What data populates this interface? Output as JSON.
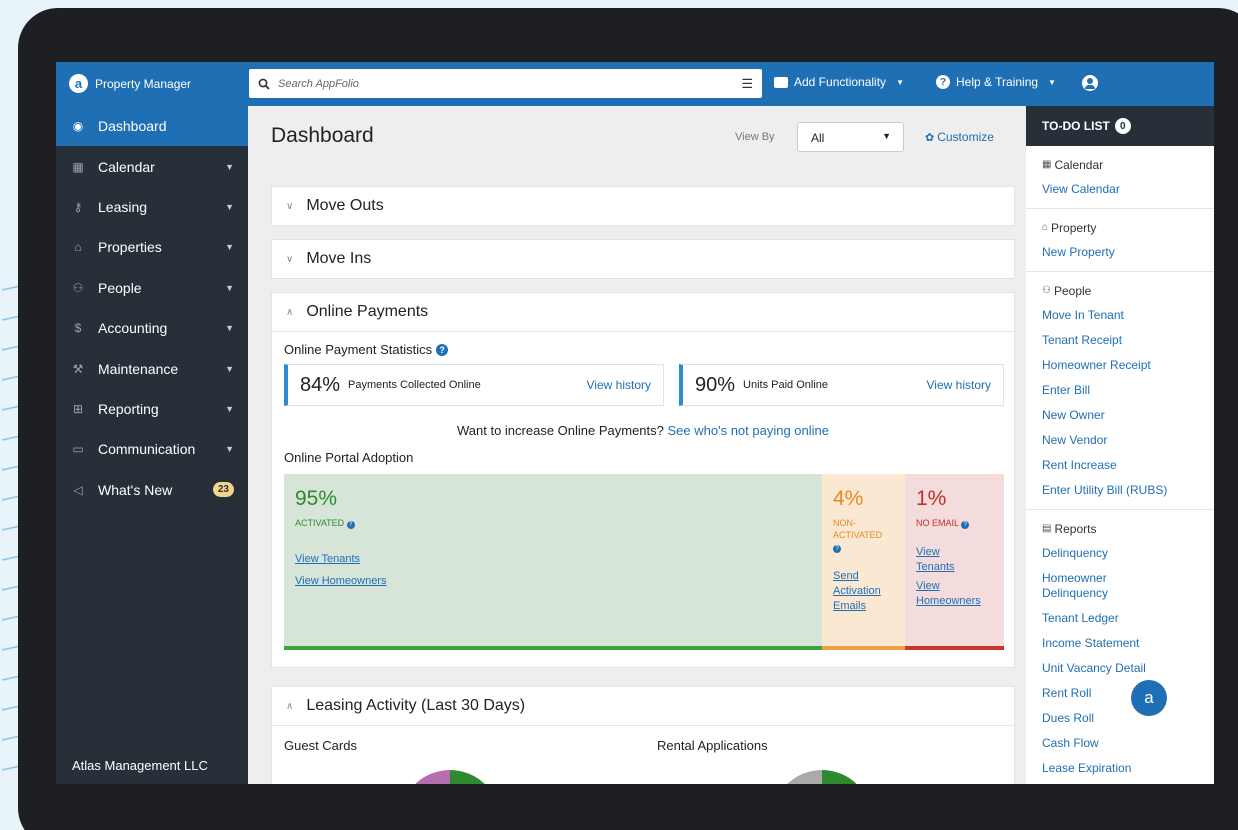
{
  "app": {
    "brand": "Property Manager"
  },
  "search": {
    "placeholder": "Search AppFolio"
  },
  "topnav": {
    "add_functionality": "Add Functionality",
    "help": "Help & Training"
  },
  "sidebar": {
    "items": [
      {
        "label": "Dashboard",
        "icon": "dashboard-icon"
      },
      {
        "label": "Calendar",
        "icon": "calendar-icon"
      },
      {
        "label": "Leasing",
        "icon": "key-icon"
      },
      {
        "label": "Properties",
        "icon": "home-icon"
      },
      {
        "label": "People",
        "icon": "people-icon"
      },
      {
        "label": "Accounting",
        "icon": "dollar-icon"
      },
      {
        "label": "Maintenance",
        "icon": "wrench-icon"
      },
      {
        "label": "Reporting",
        "icon": "table-icon"
      },
      {
        "label": "Communication",
        "icon": "message-icon"
      },
      {
        "label": "What's New",
        "icon": "megaphone-icon",
        "badge": "23"
      }
    ],
    "company": "Atlas Management LLC"
  },
  "main": {
    "title": "Dashboard",
    "view_by_label": "View By",
    "view_by_value": "All",
    "customize": "Customize",
    "panels": {
      "move_outs": "Move Outs",
      "move_ins": "Move Ins",
      "online_payments": "Online Payments",
      "leasing": "Leasing Activity (Last 30 Days)"
    },
    "online_payments": {
      "stats_title": "Online Payment Statistics",
      "stat1": {
        "pct": "84%",
        "label": "Payments Collected Online",
        "link": "View history"
      },
      "stat2": {
        "pct": "90%",
        "label": "Units Paid Online",
        "link": "View history"
      },
      "promo_text": "Want to increase Online Payments?",
      "promo_link": "See who's not paying online",
      "adoption_title": "Online Portal Adoption",
      "activated": {
        "pct": "95%",
        "status": "ACTIVATED",
        "link1": "View Tenants",
        "link2": "View Homeowners"
      },
      "non_activated": {
        "pct": "4%",
        "status": "NON-ACTIVATED",
        "link1": "Send Activation Emails"
      },
      "no_email": {
        "pct": "1%",
        "status": "NO EMAIL",
        "link1": "View Tenants",
        "link2": "View Homeowners"
      }
    },
    "leasing": {
      "guest_cards": "Guest Cards",
      "rental_applications": "Rental Applications"
    }
  },
  "todo": {
    "title": "TO-DO LIST",
    "count": "0",
    "sections": [
      {
        "header": "Calendar",
        "links": [
          "View Calendar"
        ]
      },
      {
        "header": "Property",
        "links": [
          "New Property"
        ]
      },
      {
        "header": "People",
        "links": [
          "Move In Tenant",
          "Tenant Receipt",
          "Homeowner Receipt",
          "Enter Bill",
          "New Owner",
          "New Vendor",
          "Rent Increase",
          "Enter Utility Bill (RUBS)"
        ]
      },
      {
        "header": "Reports",
        "links": [
          "Delinquency",
          "Homeowner Delinquency",
          "Tenant Ledger",
          "Income Statement",
          "Unit Vacancy Detail",
          "Rent Roll",
          "Dues Roll",
          "Cash Flow",
          "Lease Expiration"
        ]
      }
    ]
  },
  "chat": {
    "label": "a"
  },
  "colors": {
    "accent": "#1f6fb5",
    "sidebar": "#273039",
    "activated": "#2e8a2e",
    "non_activated": "#e58a1f",
    "no_email": "#c0302b"
  }
}
